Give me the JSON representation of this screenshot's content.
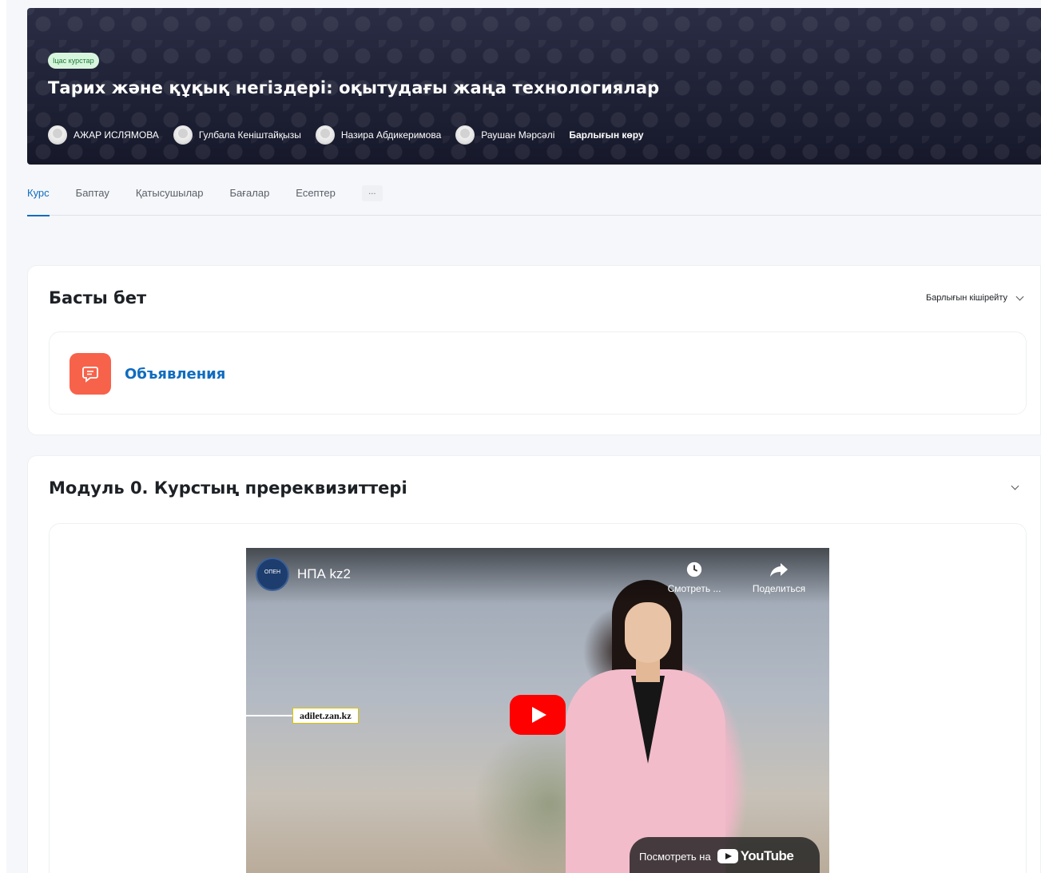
{
  "header": {
    "badge": "Іцас курстар",
    "title": "Тарих және құқық негіздері: оқытудағы жаңа технологиялар",
    "teachers": [
      "АЖАР ИСЛЯМОВА",
      "Гулбала Кеніштайқызы",
      "Назира Абдикеримова",
      "Раушан Мәрсәлі"
    ],
    "see_all": "Барлығын көру"
  },
  "tabs": [
    {
      "label": "Курс",
      "active": true
    },
    {
      "label": "Баптау"
    },
    {
      "label": "Қатысушылар"
    },
    {
      "label": "Бағалар"
    },
    {
      "label": "Есептер"
    }
  ],
  "tabs_more": "...",
  "sections": [
    {
      "title": "Басты бет",
      "collapse_all": "Барлығын кішірейту",
      "activity": {
        "name": "Объявления",
        "icon": "forum-icon"
      }
    },
    {
      "title": "Модуль 0. Курстың пререквизиттері"
    }
  ],
  "video": {
    "channel_logo_text": "ОПЕН",
    "channel_name": "НПА kz2",
    "watch_later": "Смотреть ...",
    "share": "Поделиться",
    "overlay_label": "adilet.zan.kz",
    "watch_on": "Посмотреть на",
    "youtube": "YouTube"
  },
  "colors": {
    "accent": "#0f6cbf",
    "forum_icon": "#f7624b",
    "play_button": "#ff0000"
  }
}
